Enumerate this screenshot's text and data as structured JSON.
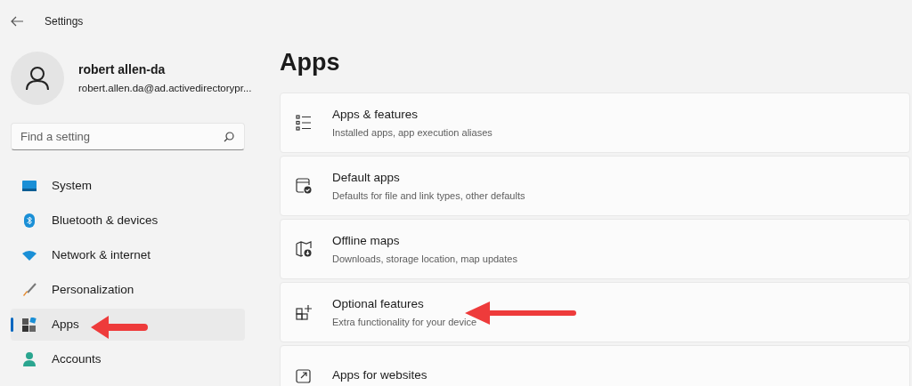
{
  "window": {
    "title": "Settings"
  },
  "profile": {
    "name": "robert allen-da",
    "email": "robert.allen.da@ad.activedirectorypr..."
  },
  "search": {
    "placeholder": "Find a setting"
  },
  "nav": [
    {
      "label": "System",
      "selected": false
    },
    {
      "label": "Bluetooth & devices",
      "selected": false
    },
    {
      "label": "Network & internet",
      "selected": false
    },
    {
      "label": "Personalization",
      "selected": false
    },
    {
      "label": "Apps",
      "selected": true
    },
    {
      "label": "Accounts",
      "selected": false
    }
  ],
  "page": {
    "title": "Apps"
  },
  "cards": [
    {
      "title": "Apps & features",
      "subtitle": "Installed apps, app execution aliases"
    },
    {
      "title": "Default apps",
      "subtitle": "Defaults for file and link types, other defaults"
    },
    {
      "title": "Offline maps",
      "subtitle": "Downloads, storage location, map updates"
    },
    {
      "title": "Optional features",
      "subtitle": "Extra functionality for your device"
    },
    {
      "title": "Apps for websites"
    }
  ]
}
